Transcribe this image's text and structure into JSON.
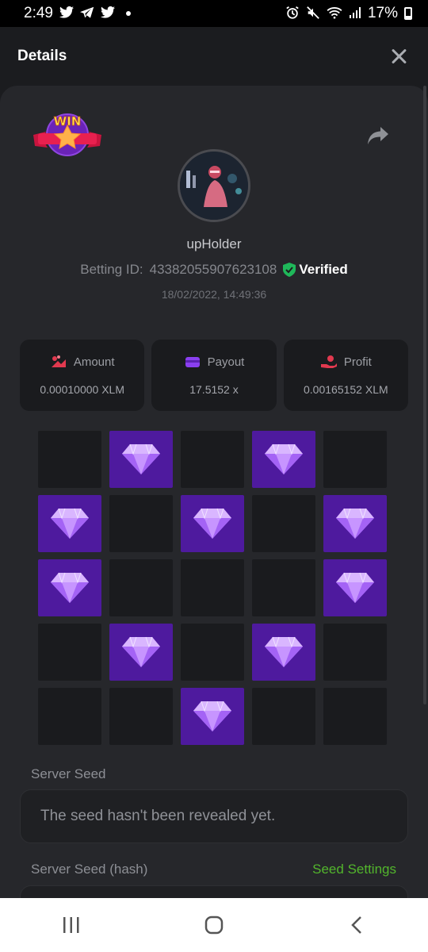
{
  "status_bar": {
    "time": "2:49",
    "battery": "17%",
    "icons": [
      "twitter-icon",
      "telegram-icon",
      "twitter-icon",
      "alarm-icon",
      "mute-icon",
      "wifi-icon",
      "signal-icon",
      "battery-icon"
    ]
  },
  "header": {
    "title": "Details",
    "close_icon": "close-icon"
  },
  "result": {
    "badge_text": "WIN",
    "share_icon": "share-icon"
  },
  "user": {
    "name": "upHolder",
    "betting_id_label": "Betting ID:",
    "betting_id": "43382055907623108",
    "verified_label": "Verified",
    "timestamp": "18/02/2022, 14:49:36"
  },
  "stats": [
    {
      "label": "Amount",
      "value": "0.00010000 XLM",
      "icon": "amount-icon",
      "color": "#e2394f"
    },
    {
      "label": "Payout",
      "value": "17.5152 x",
      "icon": "payout-icon",
      "color": "#8a3ff0"
    },
    {
      "label": "Profit",
      "value": "0.00165152 XLM",
      "icon": "profit-icon",
      "color": "#e2394f"
    }
  ],
  "grid": {
    "rows": 5,
    "cols": 5,
    "cells": [
      "empty",
      "gem",
      "empty",
      "gem",
      "empty",
      "gem",
      "empty",
      "gem",
      "empty",
      "gem",
      "gem",
      "empty",
      "empty",
      "empty",
      "gem",
      "empty",
      "gem",
      "empty",
      "gem",
      "empty",
      "empty",
      "empty",
      "gem",
      "empty",
      "empty"
    ],
    "gem_color": "#4e1a9e"
  },
  "server_seed": {
    "label": "Server Seed",
    "value": "The seed hasn't been revealed yet."
  },
  "server_seed_hash": {
    "label": "Server Seed (hash)",
    "settings_link": "Seed Settings"
  },
  "colors": {
    "background": "#1b1c1f",
    "card": "#26272b",
    "accent_green": "#52b52c",
    "verified_green": "#1fb85a"
  }
}
